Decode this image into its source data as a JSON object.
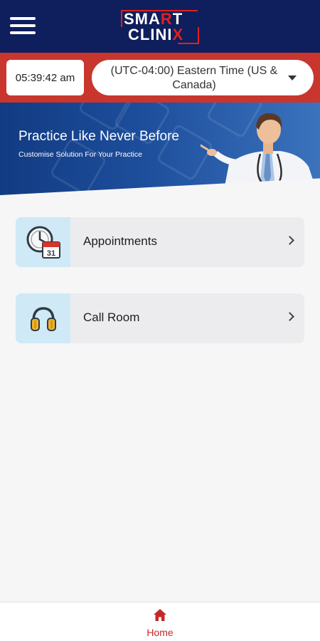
{
  "header": {
    "logo": {
      "line1_a": "SMA",
      "line1_red": "R",
      "line1_b": "T",
      "line2_a": "CLINI",
      "line2_red": "X"
    }
  },
  "timebar": {
    "clock": "05:39:42 am",
    "timezone": "(UTC-04:00) Eastern Time (US & Canada)"
  },
  "banner": {
    "title": "Practice Like Never Before",
    "subtitle": "Customise Solution For Your Practice"
  },
  "menu": [
    {
      "label": "Appointments",
      "icon": "calendar-clock-icon"
    },
    {
      "label": "Call Room",
      "icon": "headphones-icon"
    }
  ],
  "bottom_nav": {
    "home_label": "Home"
  },
  "colors": {
    "header_bg": "#0f1e5c",
    "timebar_bg": "#c8362e",
    "accent_red": "#c62828",
    "icon_box_bg": "#cfe9f6"
  }
}
